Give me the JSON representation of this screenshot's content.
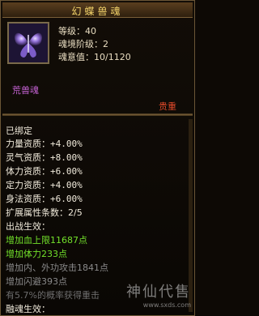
{
  "tooltip": {
    "title": "幻蝶兽魂",
    "stats": {
      "level": "等级：40",
      "realm_rank": "魂境阶级：2",
      "soul_will": "魂意值：10/1120"
    },
    "item_name": "荒兽魂",
    "quality": "贵重",
    "colors": {
      "title": "#f3d36a",
      "item_name": "#c462d2",
      "quality": "#e14a2a",
      "effect_active": "#72e02a",
      "effect_inactive": "#8a8a8a"
    }
  },
  "details": {
    "bound": "已绑定",
    "aptitudes": [
      "力量资质：+4.00%",
      "灵气资质：+8.00%",
      "体力资质：+6.00%",
      "定力资质：+4.00%",
      "身法资质：+6.00%"
    ],
    "extra_attr_count": "扩展属性条数：2/5",
    "battle_effect_header": "出战生效：",
    "battle_effects": [
      "增加血上限11687点",
      "增加体力233点",
      "增加内、外功攻击1841点",
      "增加闪避393点",
      "有5.7%的概率获得重击"
    ],
    "fusion_effect_header": "融魂生效："
  },
  "watermark": {
    "name": "神仙代售",
    "url": "www.sxds.com"
  }
}
